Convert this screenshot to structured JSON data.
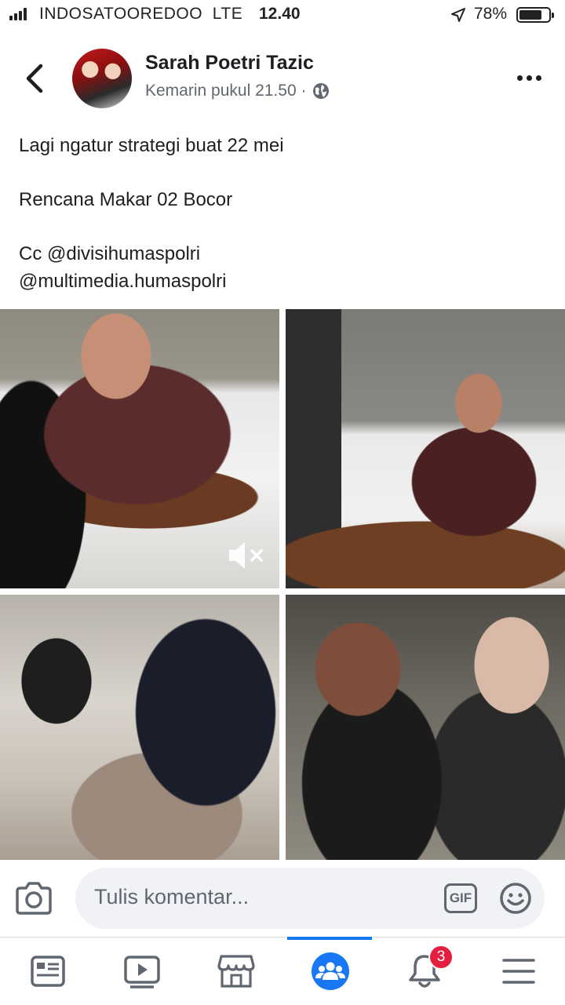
{
  "status_bar": {
    "carrier": "INDOSATOOREDOO",
    "network": "LTE",
    "time": "12.40",
    "battery": "78%",
    "battery_level": 0.78
  },
  "post": {
    "author": "Sarah Poetri Tazic",
    "timestamp": "Kemarin pukul 21.50 ·",
    "audience_icon": "globe-icon",
    "lines": [
      "Lagi ngatur strategi buat 22 mei",
      "Rencana Makar 02 Bocor",
      "Cc @divisihumaspolri",
      "@multimedia.humaspolri"
    ]
  },
  "comment": {
    "placeholder": "Tulis komentar...",
    "gif_label": "GIF"
  },
  "nav": {
    "items": [
      "news-feed-icon",
      "watch-icon",
      "marketplace-icon",
      "groups-icon",
      "notifications-icon",
      "menu-icon"
    ],
    "active": "groups-icon",
    "notification_count": "3"
  },
  "colors": {
    "accent": "#1877f2",
    "badge": "#e41e3f",
    "text": "#1c1e21",
    "secondary_text": "#606770",
    "comment_bg": "#f0f2f5"
  }
}
